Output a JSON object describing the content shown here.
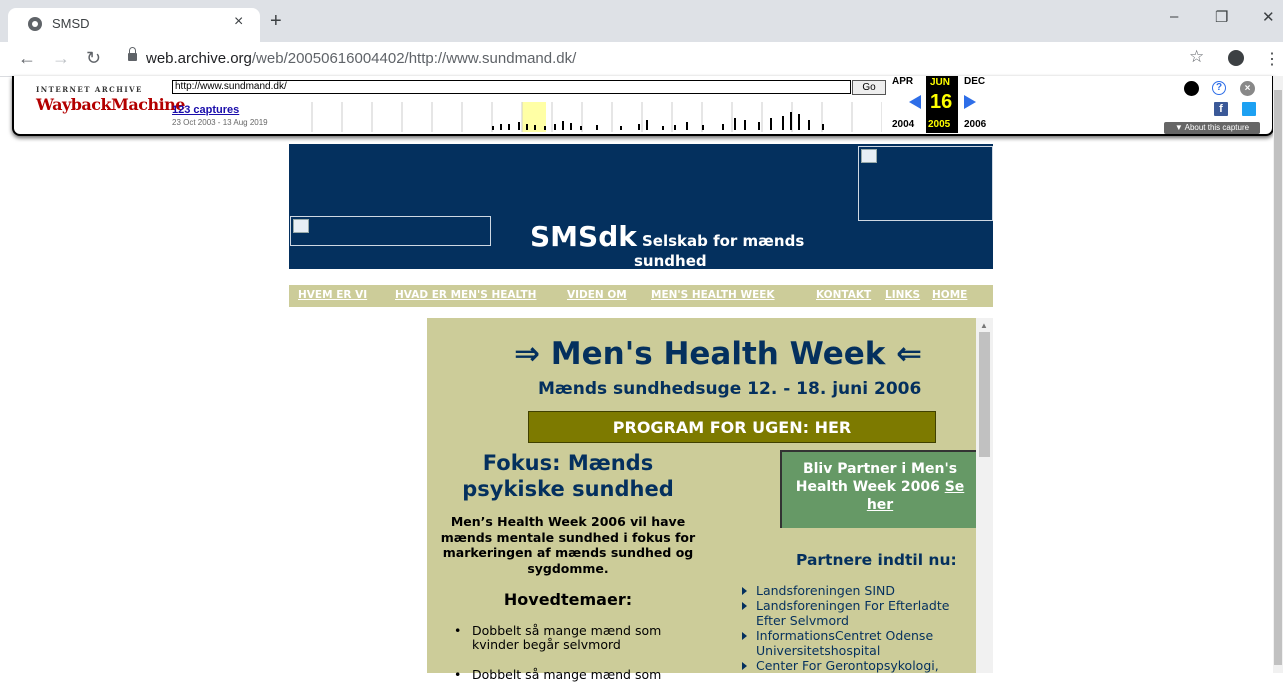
{
  "browser": {
    "tab_title": "SMSD",
    "tab_close": "×",
    "new_tab": "+",
    "url_host": "web.archive.org",
    "url_path": "/web/20050616004402/http://www.sundmand.dk/",
    "win_min": "–",
    "win_max": "❐",
    "win_close": "✕"
  },
  "wayback": {
    "logo_top": "INTERNET ARCHIVE",
    "logo_main": "WaybackMachine",
    "url_value": "http://www.sundmand.dk/",
    "go_label": "Go",
    "captures": "123 captures",
    "range": "23 Oct 2003 - 13 Aug 2019",
    "prev_month": "APR",
    "cur_month": "JUN",
    "next_month": "DEC",
    "day": "16",
    "prev_year": "2004",
    "cur_year": "2005",
    "next_year": "2006",
    "about": "▼ About this capture"
  },
  "site": {
    "logo": "SMSdk",
    "logo_sub_1": "Selskab for mænds",
    "logo_sub_2": "sundhed",
    "nav": [
      "HVEM ER VI",
      "HVAD ER MEN'S HEALTH",
      "VIDEN OM",
      "MEN'S HEALTH WEEK",
      "KONTAKT",
      "LINKS",
      "HOME"
    ],
    "headline": "⇒ Men's Health Week ⇐",
    "dates": "Mænds sundhedsuge 12. - 18. juni 2006",
    "program": "PROGRAM FOR UGEN: HER",
    "fokus": "Fokus: Mænds psykiske sundhed",
    "intro": "Men’s Health Week 2006 vil have mænds mentale sundhed i fokus for markeringen af mænds sundhed og sygdomme.",
    "hovedtemaer": "Hovedtemaer:",
    "bullets": [
      "Dobbelt så mange mænd som kvinder begår selvmord",
      "Dobbelt så mange mænd som"
    ],
    "partner_box_line1": "Bliv Partner i Men's Health Week 2006",
    "partner_box_link": "Se her",
    "partnere_heading": "Partnere indtil nu:",
    "partners": [
      "Landsforeningen SIND",
      "Landsforeningen For Efterladte Efter Selvmord",
      "InformationsCentret Odense Universitetshospital",
      "Center For Gerontopsykologi,"
    ]
  }
}
